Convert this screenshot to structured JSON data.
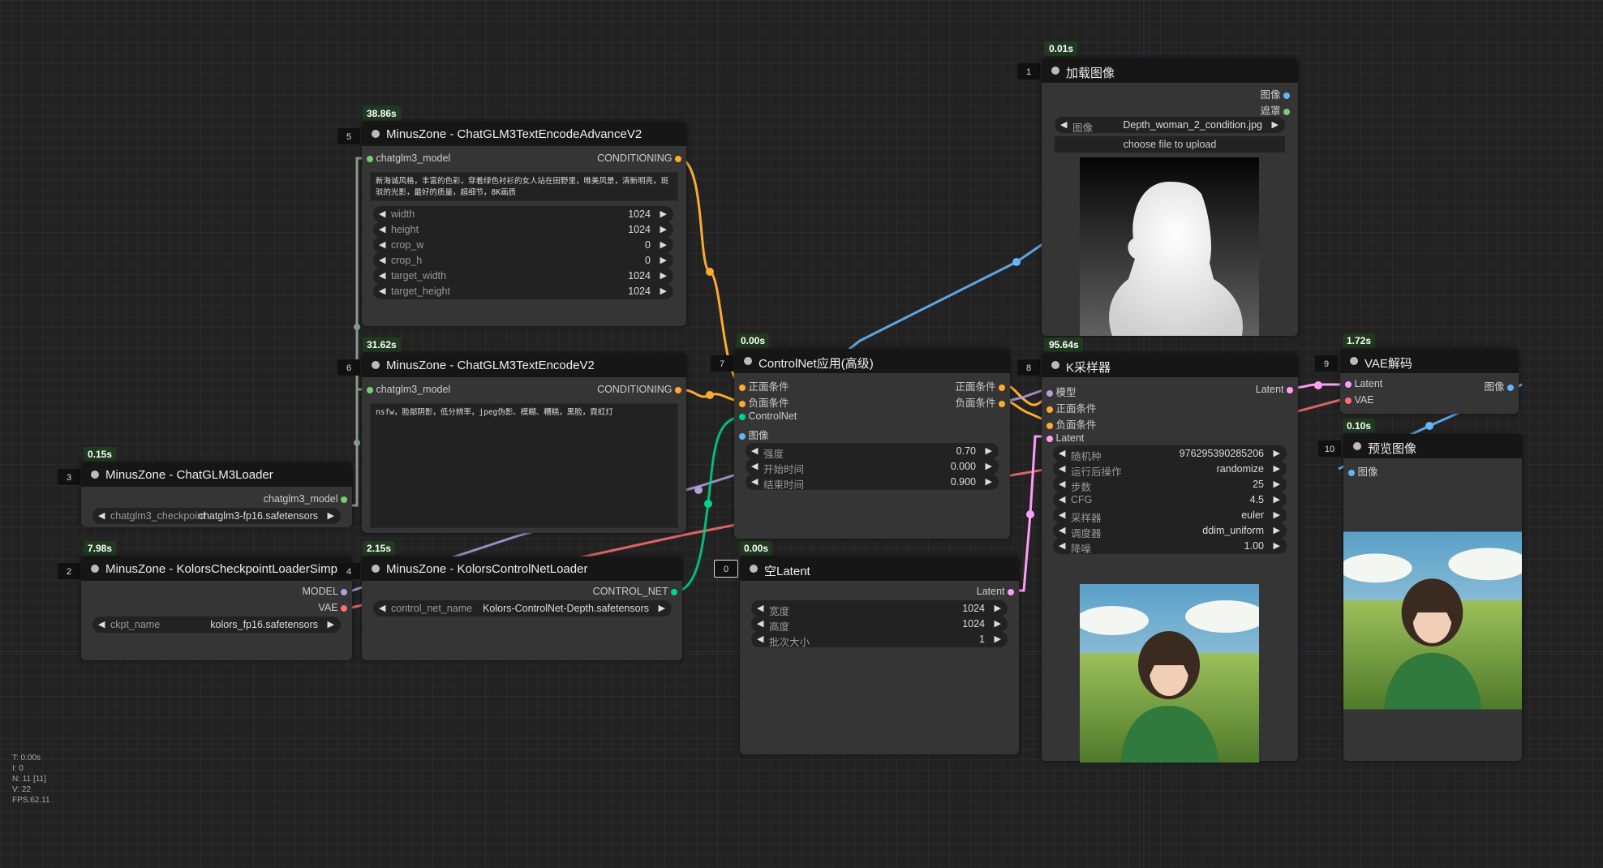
{
  "colors": {
    "clip": "#6fd172",
    "conditioning": "#ffa931",
    "model": "#b39ddb",
    "vae": "#ff6e6e",
    "control_net": "#00d68a",
    "image": "#64b5f6",
    "latent": "#ff9cf9",
    "mask": "#81c784"
  },
  "nodes": {
    "n1": {
      "id": "1",
      "time": "0.01s",
      "title": "加载图像",
      "out_image": "图像",
      "out_mask": "遮罩",
      "w_image_label": "图像",
      "w_image_value": "Depth_woman_2_condition.jpg",
      "upload": "choose file to upload",
      "preview_icon": "depth-map-woman-image"
    },
    "n2": {
      "id": "2",
      "time": "7.98s",
      "title": "MinusZone - KolorsCheckpointLoaderSimple",
      "out_model": "MODEL",
      "out_vae": "VAE",
      "w_ckpt_label": "ckpt_name",
      "w_ckpt_value": "kolors_fp16.safetensors"
    },
    "n3": {
      "id": "3",
      "time": "0.15s",
      "title": "MinusZone - ChatGLM3Loader",
      "out_model": "chatglm3_model",
      "w_label": "chatglm3_checkpoint",
      "w_value": "chatglm3-fp16.safetensors"
    },
    "n4": {
      "id": "4",
      "time": "2.15s",
      "title": "MinusZone - KolorsControlNetLoader",
      "out": "CONTROL_NET",
      "w_label": "control_net_name",
      "w_value": "Kolors-ControlNet-Depth.safetensors"
    },
    "n5": {
      "id": "5",
      "time": "38.86s",
      "title": "MinusZone - ChatGLM3TextEncodeAdvanceV2",
      "in": "chatglm3_model",
      "out": "CONDITIONING",
      "text": "新海诚风格，丰富的色彩，穿着绿色衬衫的女人站在田野里，唯美风景，清新明亮，斑驳的光影，最好的质量，超细节，8K画质",
      "widgets": [
        {
          "label": "width",
          "value": "1024"
        },
        {
          "label": "height",
          "value": "1024"
        },
        {
          "label": "crop_w",
          "value": "0"
        },
        {
          "label": "crop_h",
          "value": "0"
        },
        {
          "label": "target_width",
          "value": "1024"
        },
        {
          "label": "target_height",
          "value": "1024"
        }
      ]
    },
    "n6": {
      "id": "6",
      "time": "31.62s",
      "title": "MinusZone - ChatGLM3TextEncodeV2",
      "in": "chatglm3_model",
      "out": "CONDITIONING",
      "text": "nsfw，脸部阴影，低分辨率，jpeg伪影、模糊、糟糕，黑脸，霓虹灯"
    },
    "n7": {
      "id": "7",
      "time": "0.00s",
      "title": "ControlNet应用(高级)",
      "in_pos": "正面条件",
      "in_neg": "负面条件",
      "in_cn": "ControlNet",
      "in_img": "图像",
      "out_pos": "正面条件",
      "out_neg": "负面条件",
      "widgets": [
        {
          "label": "强度",
          "value": "0.70"
        },
        {
          "label": "开始时间",
          "value": "0.000"
        },
        {
          "label": "结束时间",
          "value": "0.900"
        }
      ]
    },
    "n8": {
      "id": "8",
      "time": "95.64s",
      "title": "K采样器",
      "in_model": "模型",
      "in_pos": "正面条件",
      "in_neg": "负面条件",
      "in_latent": "Latent",
      "out": "Latent",
      "widgets": [
        {
          "label": "随机种",
          "value": "976295390285206"
        },
        {
          "label": "运行后操作",
          "value": "randomize"
        },
        {
          "label": "步数",
          "value": "25"
        },
        {
          "label": "CFG",
          "value": "4.5"
        },
        {
          "label": "采样器",
          "value": "euler"
        },
        {
          "label": "调度器",
          "value": "ddim_uniform"
        },
        {
          "label": "降噪",
          "value": "1.00"
        }
      ],
      "preview_icon": "generated-woman-field-image"
    },
    "n9": {
      "id": "9",
      "time": "1.72s",
      "title": "VAE解码",
      "in_latent": "Latent",
      "in_vae": "VAE",
      "out": "图像"
    },
    "n10": {
      "id": "10",
      "time": "0.10s",
      "title": "预览图像",
      "in": "图像",
      "preview_icon": "generated-woman-field-image"
    },
    "n0": {
      "id": "0",
      "time": "0.00s",
      "title": "空Latent",
      "out": "Latent",
      "widgets": [
        {
          "label": "宽度",
          "value": "1024"
        },
        {
          "label": "高度",
          "value": "1024"
        },
        {
          "label": "批次大小",
          "value": "1"
        }
      ]
    }
  },
  "stats": {
    "t": "T: 0.00s",
    "i": "I: 0",
    "n": "N: 11 [11]",
    "v": "V: 22",
    "fps": "FPS:62.11"
  }
}
